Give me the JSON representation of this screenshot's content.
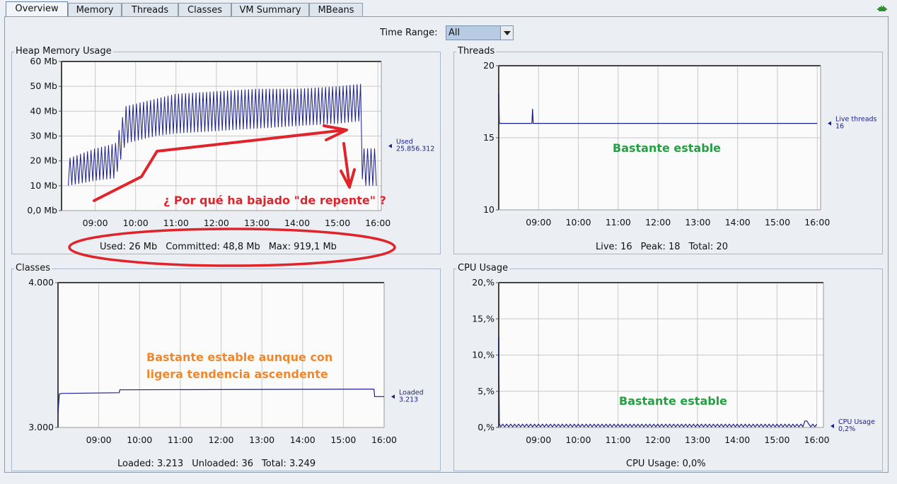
{
  "tabs": [
    "Overview",
    "Memory",
    "Threads",
    "Classes",
    "VM Summary",
    "MBeans"
  ],
  "time_range": {
    "label": "Time Range:",
    "value": "All"
  },
  "x_ticks": [
    "09:00",
    "10:00",
    "11:00",
    "12:00",
    "13:00",
    "14:00",
    "15:00",
    "16:00"
  ],
  "heap": {
    "title": "Heap Memory Usage",
    "y_ticks": [
      "60 Mb",
      "50 Mb",
      "40 Mb",
      "30 Mb",
      "20 Mb",
      "10 Mb",
      "0,0 Mb"
    ],
    "legend_name": "Used",
    "legend_value": "25.856.312",
    "footer": {
      "used_label": "Used:",
      "used_value": "26 Mb",
      "committed_label": "Committed:",
      "committed_value": "48,8 Mb",
      "max_label": "Max:",
      "max_value": "919,1 Mb"
    },
    "annotation": "¿ Por qué ha bajado \"de repente\" ?"
  },
  "threads": {
    "title": "Threads",
    "y_ticks": [
      "20",
      "15",
      "10"
    ],
    "legend_name": "Live threads",
    "legend_value": "16",
    "footer": {
      "live_label": "Live:",
      "live_value": "16",
      "peak_label": "Peak:",
      "peak_value": "18",
      "total_label": "Total:",
      "total_value": "20"
    },
    "annotation": "Bastante estable"
  },
  "classes": {
    "title": "Classes",
    "y_ticks": [
      "4.000",
      "3.000"
    ],
    "legend_name": "Loaded",
    "legend_value": "3.213",
    "footer": {
      "loaded_label": "Loaded:",
      "loaded_value": "3.213",
      "unloaded_label": "Unloaded:",
      "unloaded_value": "36",
      "total_label": "Total:",
      "total_value": "3.249"
    },
    "annotation_line1": "Bastante estable aunque con",
    "annotation_line2": "ligera tendencia ascendente"
  },
  "cpu": {
    "title": "CPU Usage",
    "y_ticks": [
      "20,%",
      "15,%",
      "10,%",
      "5,%",
      "0,%"
    ],
    "legend_name": "CPU Usage",
    "legend_value": "0,2%",
    "footer": {
      "label": "CPU Usage:",
      "value": "0,0%"
    },
    "annotation": "Bastante estable"
  },
  "chart_data": [
    {
      "type": "line",
      "title": "Heap Memory Usage",
      "x": [
        "08:20",
        "09:00",
        "09:30",
        "09:45",
        "10:30",
        "11:00",
        "12:00",
        "13:00",
        "14:00",
        "15:00",
        "15:35",
        "15:37",
        "16:00"
      ],
      "series": [
        {
          "name": "Used",
          "low": [
            10,
            12,
            13,
            27,
            30,
            31,
            32,
            33,
            34,
            35,
            36,
            10,
            10
          ],
          "high": [
            21,
            25,
            27,
            42,
            45,
            47,
            48,
            49,
            49,
            50,
            51,
            25,
            25
          ]
        }
      ],
      "ylim": [
        0,
        60
      ],
      "y_unit": "Mb"
    },
    {
      "type": "line",
      "title": "Threads",
      "x": [
        "08:00",
        "08:01",
        "08:05",
        "08:50",
        "08:51",
        "08:52",
        "16:00"
      ],
      "series": [
        {
          "name": "Live threads",
          "values": [
            18,
            16,
            16,
            16,
            17,
            16,
            16
          ]
        }
      ],
      "ylim": [
        10,
        20
      ]
    },
    {
      "type": "line",
      "title": "Classes",
      "x": [
        "08:00",
        "08:02",
        "08:05",
        "09:30",
        "09:31",
        "15:45",
        "15:46",
        "16:00"
      ],
      "series": [
        {
          "name": "Loaded",
          "values": [
            3100,
            3230,
            3235,
            3240,
            3260,
            3265,
            3213,
            3213
          ]
        }
      ],
      "ylim": [
        3000,
        4000
      ]
    },
    {
      "type": "line",
      "title": "CPU Usage",
      "x": [
        "08:00",
        "08:01",
        "08:03",
        "12:00",
        "15:45",
        "16:00"
      ],
      "series": [
        {
          "name": "CPU Usage",
          "values": [
            12.5,
            0.5,
            0.2,
            0.2,
            0.8,
            0.2
          ]
        }
      ],
      "ylim": [
        0,
        20
      ]
    }
  ]
}
